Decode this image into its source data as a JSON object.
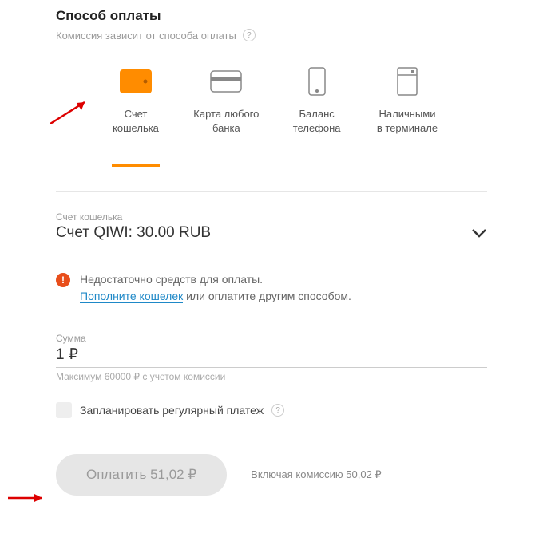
{
  "header": {
    "title": "Способ оплаты",
    "commission_note": "Комиссия зависит от способа оплаты"
  },
  "methods": {
    "wallet": {
      "label_line1": "Счет",
      "label_line2": "кошелька"
    },
    "card": {
      "label_line1": "Карта любого",
      "label_line2": "банка"
    },
    "phone": {
      "label_line1": "Баланс",
      "label_line2": "телефона"
    },
    "cash": {
      "label_line1": "Наличными",
      "label_line2": "в терминале"
    }
  },
  "account": {
    "label": "Счет кошелька",
    "value": "Счет QIWI: 30.00 RUB"
  },
  "warning": {
    "line1": "Недостаточно средств для оплаты.",
    "link": "Пополните кошелек",
    "line2_rest": " или оплатите другим способом."
  },
  "amount": {
    "label": "Сумма",
    "value": "1 ₽",
    "hint": "Максимум 60000 ₽ с учетом комиссии"
  },
  "schedule": {
    "label": "Запланировать регулярный платеж"
  },
  "footer": {
    "pay_label": "Оплатить 51,02 ₽",
    "commission_text": "Включая комиссию 50,02 ₽"
  }
}
